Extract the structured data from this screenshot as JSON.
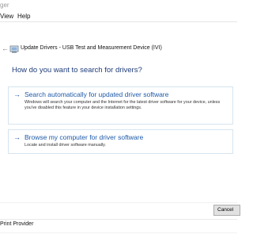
{
  "window": {
    "title_fragment": "ger"
  },
  "menu": {
    "view": "View",
    "help": "Help"
  },
  "dialog": {
    "back_arrow": "←",
    "title": "Update Drivers - USB Test and Measurement Device (IVI)",
    "prompt": "How do you want to search for drivers?",
    "options": [
      {
        "arrow": "→",
        "title": "Search automatically for updated driver software",
        "description": "Windows will search your computer and the Internet for the latest driver software for your device, unless you've disabled this feature in your device installation settings."
      },
      {
        "arrow": "→",
        "title": "Browse my computer for driver software",
        "description": "Locate and install driver software manually."
      }
    ],
    "cancel_label": "Cancel"
  },
  "background": {
    "list_item": "Print Provider"
  },
  "colors": {
    "link_blue": "#1e5aa8",
    "prompt_blue": "#1f3d7a",
    "option_border": "#d6e4f0"
  }
}
